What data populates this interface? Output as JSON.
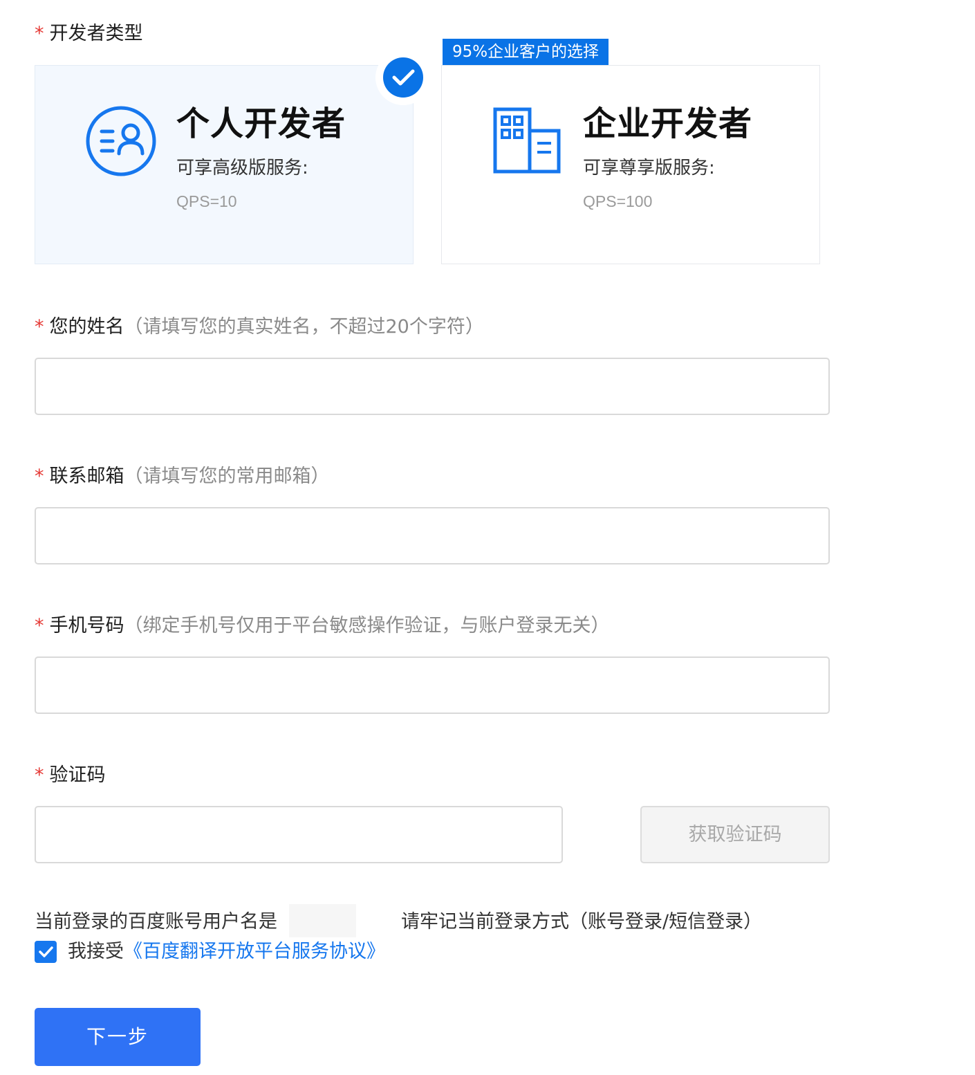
{
  "developer_type": {
    "label": "开发者类型",
    "options": [
      {
        "title": "个人开发者",
        "desc": "可享高级版服务:",
        "qps": "QPS=10",
        "selected": true
      },
      {
        "title": "企业开发者",
        "desc": "可享尊享版服务:",
        "qps": "QPS=100",
        "selected": false
      }
    ],
    "enterprise_tag": "95%企业客户的选择"
  },
  "name_field": {
    "label": "您的姓名",
    "hint": "（请填写您的真实姓名，不超过20个字符）",
    "value": ""
  },
  "email_field": {
    "label": "联系邮箱",
    "hint": "（请填写您的常用邮箱）",
    "value": ""
  },
  "phone_field": {
    "label": "手机号码",
    "hint": "（绑定手机号仅用于平台敏感操作验证，与账户登录无关）",
    "value": ""
  },
  "code_field": {
    "label": "验证码",
    "value": "",
    "button_label": "获取验证码"
  },
  "account_notice": {
    "prefix": "当前登录的百度账号用户名是",
    "remember": "请牢记当前登录方式（账号登录/短信登录）"
  },
  "agreement": {
    "checked": true,
    "text": "我接受",
    "link": "《百度翻译开放平台服务协议》"
  },
  "next_button": "下一步",
  "colors": {
    "accent": "#1677ee",
    "required": "#e53935",
    "primary_button": "#2f72f5"
  }
}
